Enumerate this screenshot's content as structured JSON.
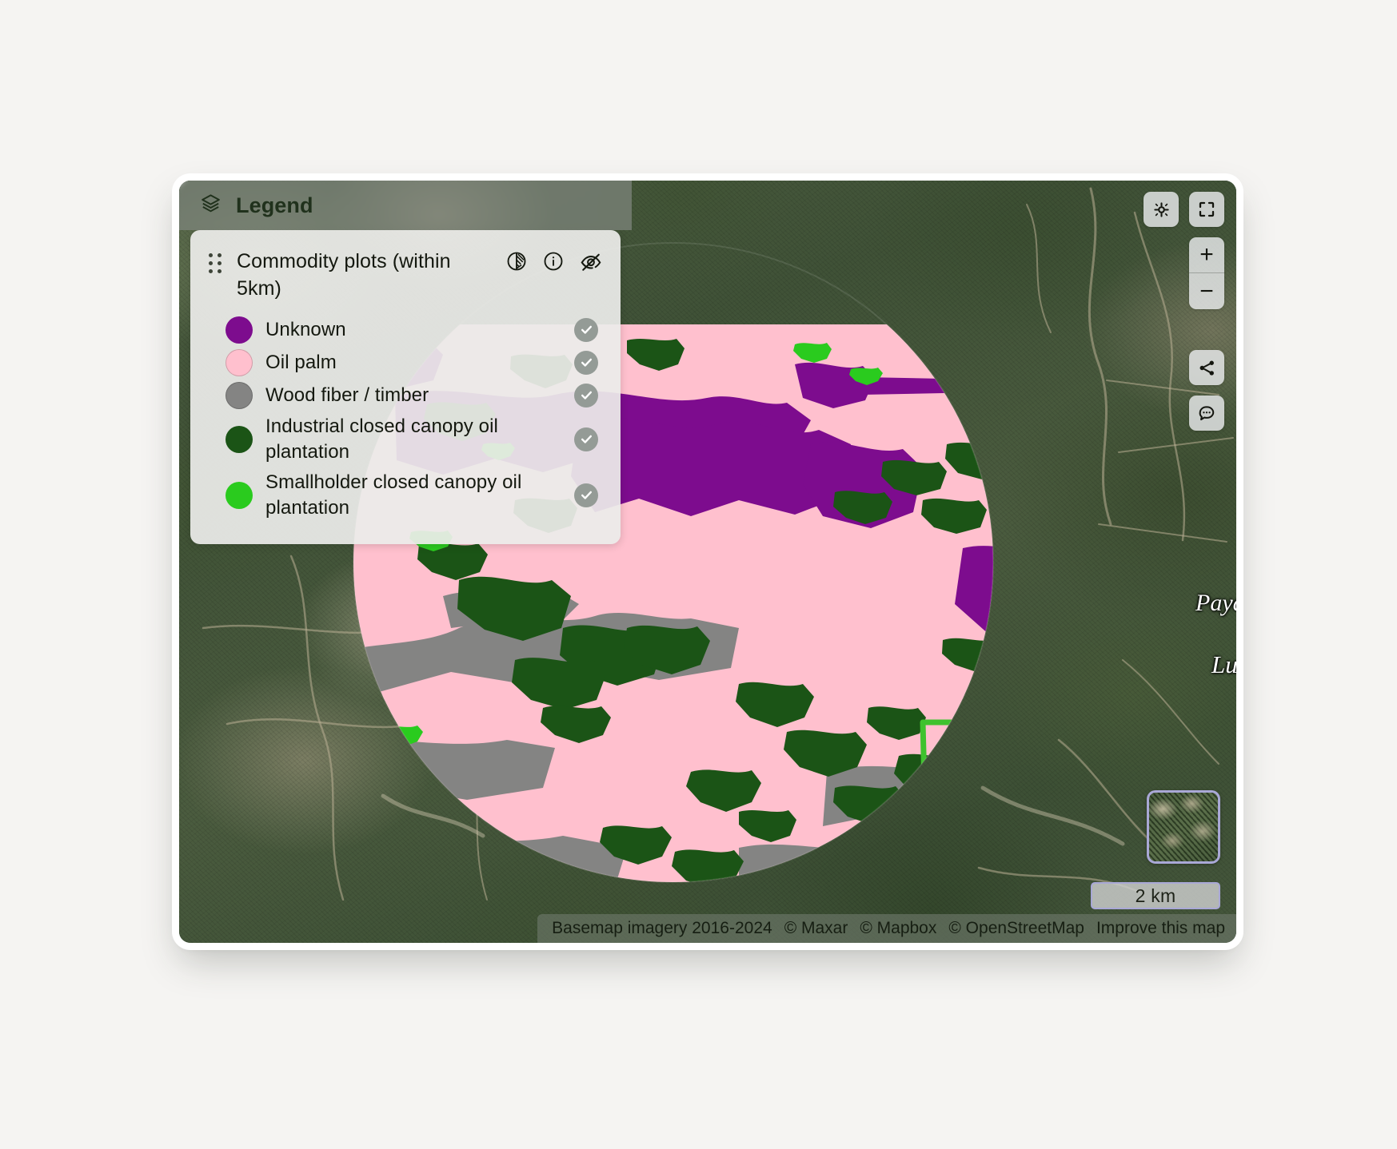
{
  "legend": {
    "header_title": "Legend",
    "header_icon": "layers-icon",
    "layer": {
      "title": "Commodity plots (within 5km)",
      "actions": [
        {
          "name": "opacity-icon",
          "label": "Opacity"
        },
        {
          "name": "info-icon",
          "label": "Info"
        },
        {
          "name": "eye-off-icon",
          "label": "Hide layer"
        }
      ],
      "items": [
        {
          "label": "Unknown",
          "color": "#7D0C8E",
          "checked": true
        },
        {
          "label": "Oil palm",
          "color": "#FFC0CE",
          "checked": true
        },
        {
          "label": "Wood fiber / timber",
          "color": "#848483",
          "checked": true
        },
        {
          "label": "Industrial closed canopy oil plantation",
          "color": "#1B5416",
          "checked": true
        },
        {
          "label": "Smallholder closed canopy oil plantation",
          "color": "#2ACB1E",
          "checked": true
        }
      ]
    }
  },
  "map": {
    "labels": [
      {
        "name": "map-label-payah",
        "text": "Payah"
      },
      {
        "name": "map-label-lung",
        "text": "Lung"
      }
    ],
    "controls": {
      "recenter": "recenter-icon",
      "fullscreen": "fullscreen-icon",
      "zoom_in": "+",
      "zoom_out": "−",
      "share": "share-icon",
      "feedback": "chat-icon"
    },
    "scale_bar": "2 km",
    "minimap": "minimap-thumbnail",
    "attribution": {
      "basemap": "Basemap imagery 2016-2024",
      "maxar": "© Maxar",
      "mapbox": "© Mapbox",
      "osm": "© OpenStreetMap",
      "improve": "Improve this map"
    }
  },
  "colors": {
    "unknown": "#7D0C8E",
    "oil_palm": "#FFC0CE",
    "wood_fiber": "#848483",
    "industrial_plantation": "#1B5416",
    "smallholder_plantation": "#2ACB1E",
    "selected_plot_outline": "#3FC22E",
    "page_background": "#F5F4F2"
  }
}
